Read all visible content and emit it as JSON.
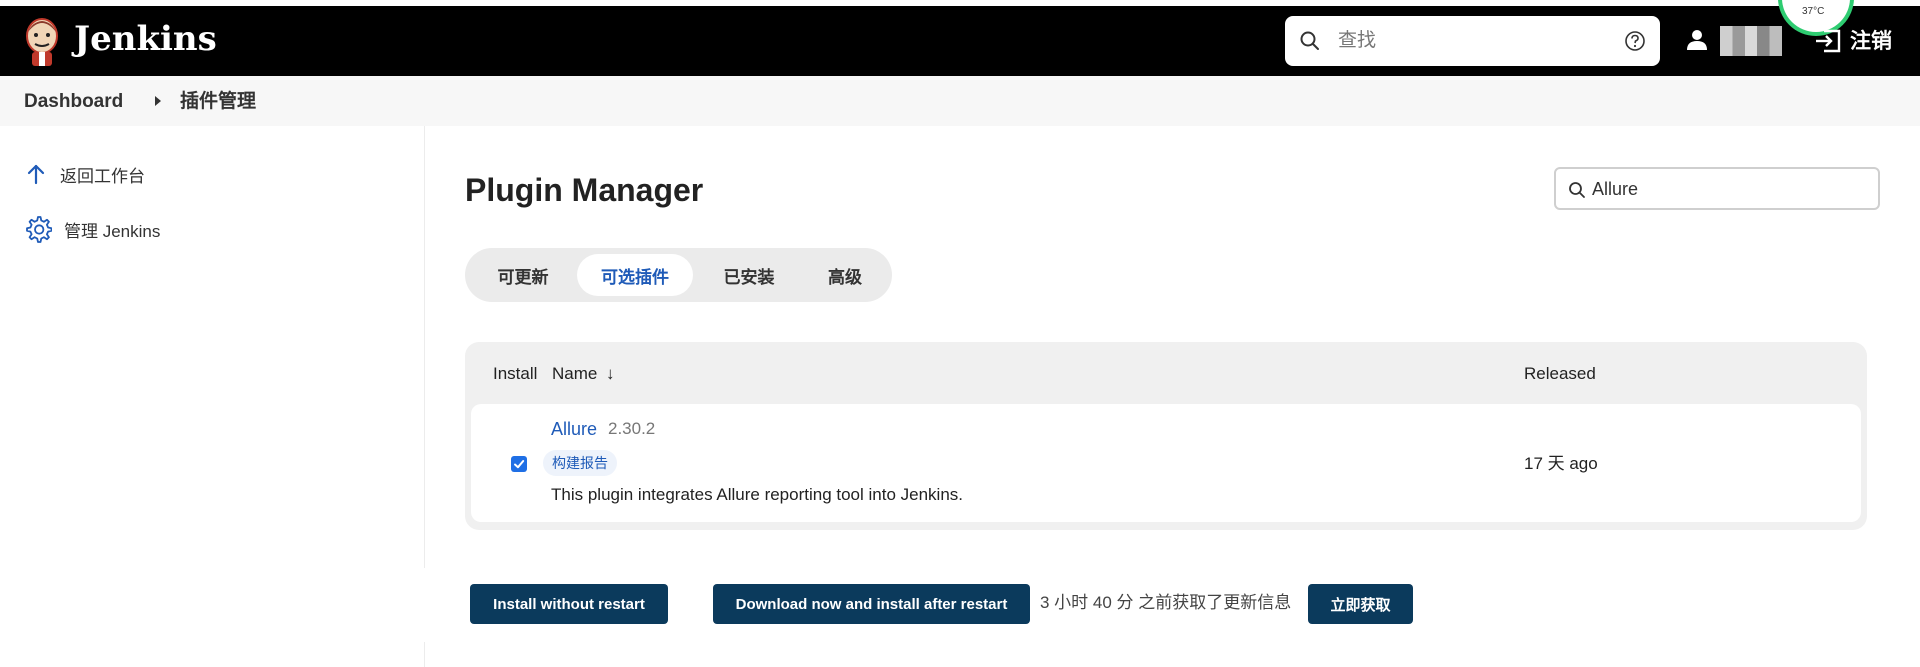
{
  "header": {
    "brand": "Jenkins",
    "search_placeholder": "查找",
    "logout_label": "注销",
    "temperature": "37°C"
  },
  "breadcrumb": {
    "items": [
      "Dashboard",
      "插件管理"
    ]
  },
  "sidebar": {
    "items": [
      {
        "label": "返回工作台",
        "icon": "arrow-up-icon"
      },
      {
        "label": "管理 Jenkins",
        "icon": "gear-icon"
      }
    ]
  },
  "main": {
    "title": "Plugin Manager",
    "filter_value": "Allure",
    "tabs": [
      {
        "label": "可更新",
        "active": false
      },
      {
        "label": "可选插件",
        "active": true
      },
      {
        "label": "已安装",
        "active": false
      },
      {
        "label": "高级",
        "active": false
      }
    ],
    "table": {
      "headers": {
        "install": "Install",
        "name": "Name",
        "sort_indicator": "↓",
        "released": "Released"
      },
      "rows": [
        {
          "name": "Allure",
          "version": "2.30.2",
          "tag": "构建报告",
          "description": "This plugin integrates Allure reporting tool into Jenkins.",
          "released": "17 天 ago",
          "checked": true
        }
      ]
    },
    "actions": {
      "install_without_restart": "Install without restart",
      "download_install_after_restart": "Download now and install after restart",
      "update_info": "3 小时 40 分 之前获取了更新信息",
      "fetch_now": "立即获取"
    }
  },
  "colors": {
    "header_bg": "#000000",
    "accent": "#1f5bb8",
    "primary_button": "#0b3a5c",
    "checkbox": "#1f6fe5"
  }
}
